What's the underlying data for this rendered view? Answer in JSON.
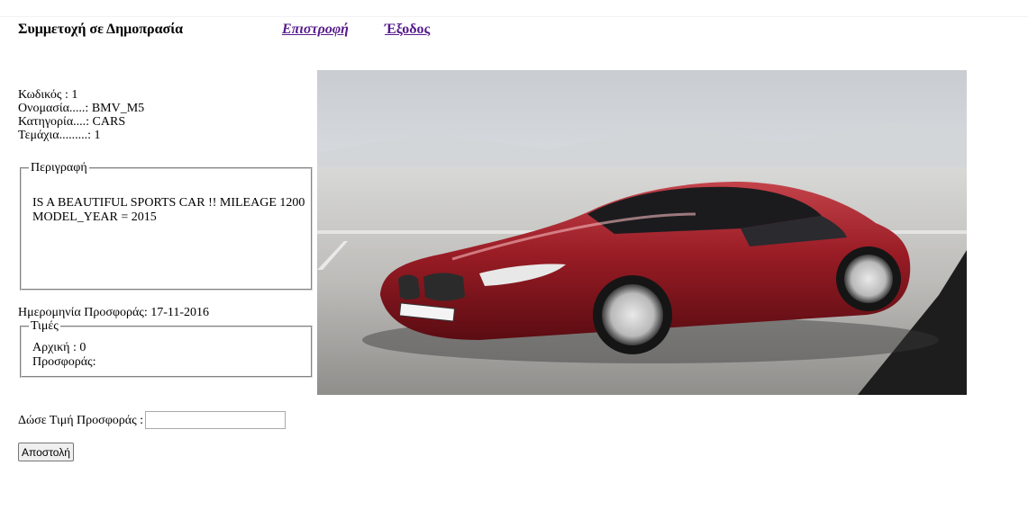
{
  "header": {
    "title": "Συμμετοχή σε Δημοπρασία",
    "back_link": "Επιστροφή",
    "exit_link": "Έξοδος"
  },
  "item": {
    "code_line": "Κωδικός : 1",
    "name_line": "Ονομασία.....: BMV_M5",
    "category_line": "Κατηγορία....: CARS",
    "pieces_line": "Τεμάχια.........: 1"
  },
  "description": {
    "legend": "Περιγραφή",
    "text": "IS A BEAUTIFUL SPORTS CAR !! MILEAGE 1200 MODEL_YEAR = 2015"
  },
  "offer_date_line": "Ημερομηνία Προσφοράς: 17-11-2016",
  "prices": {
    "legend": "Τιμές",
    "initial_line": "Αρχική : 0",
    "offer_line": "Προσφοράς:"
  },
  "bid": {
    "label": "Δώσε Τιμή Προσφοράς :",
    "value": ""
  },
  "submit_label": "Αποστολή",
  "colors": {
    "visited_link": "#551a8b",
    "car_body": "#8e1a22"
  }
}
